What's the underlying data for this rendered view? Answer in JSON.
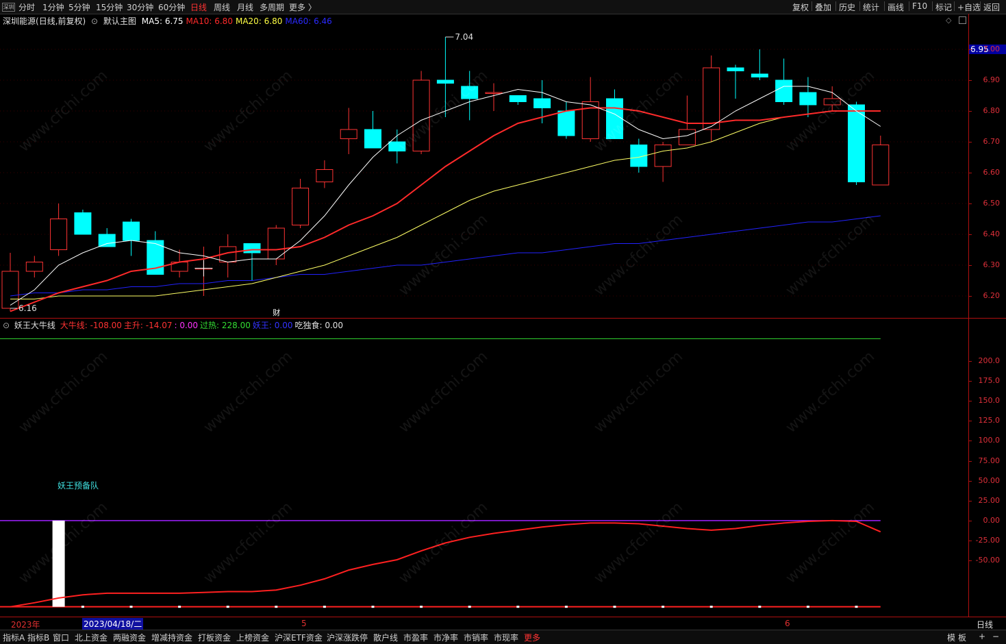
{
  "topbar": {
    "icon_label": "深圳",
    "periods": [
      "分时",
      "1分钟",
      "5分钟",
      "15分钟",
      "30分钟",
      "60分钟",
      "日线",
      "周线",
      "月线",
      "多周期",
      "更多 〉"
    ],
    "active_period": "日线",
    "tools": [
      "复权",
      "叠加",
      "历史",
      "统计",
      "画线",
      "F10",
      "标记",
      "+自选",
      "返回"
    ]
  },
  "main": {
    "stock_name": "深圳能源",
    "adj_mode": "(日线,前复权)",
    "chart_name": "默认主图",
    "ma": [
      {
        "label": "MA5:",
        "value": "6.75",
        "color": "#ffffff"
      },
      {
        "label": "MA10:",
        "value": "6.80",
        "color": "#ff2a2a"
      },
      {
        "label": "MA20:",
        "value": "6.80",
        "color": "#ffff44"
      },
      {
        "label": "MA60:",
        "value": "6.46",
        "color": "#2a2aff"
      }
    ],
    "current_price": "6.95",
    "high_label": "7.04",
    "low_label": "6.16",
    "finance_marker": "财",
    "y_ticks": [
      "7.00",
      "6.90",
      "6.80",
      "6.70",
      "6.60",
      "6.50",
      "6.40",
      "6.30",
      "6.20"
    ]
  },
  "indicator": {
    "name": "妖王大牛线",
    "items": [
      {
        "label": "大牛线:",
        "value": "-108.00",
        "color": "#ff3333"
      },
      {
        "label": "主升:",
        "value": "-14.07",
        "color": "#ff3333"
      },
      {
        "label": "",
        "value": ": 0.00",
        "color": "#ff33ff"
      },
      {
        "label": "过热:",
        "value": "228.00",
        "color": "#33dd33"
      },
      {
        "label": "妖王:",
        "value": "0.00",
        "color": "#3333ff"
      },
      {
        "label": "吃独食:",
        "value": "0.00",
        "color": "#e0e0e0"
      }
    ],
    "annotation": "妖王预备队",
    "y_ticks": [
      "200.0",
      "175.0",
      "150.0",
      "125.0",
      "100.0",
      "75.00",
      "50.00",
      "25.00",
      "0.00",
      "-25.00",
      "-50.00"
    ]
  },
  "xaxis": {
    "year_label": "2023年",
    "cursor_date": "2023/04/18/二",
    "month5": "5",
    "month6": "6",
    "period_label": "日线"
  },
  "bottombar": {
    "tabs": [
      "指标A",
      "指标B",
      "窗口",
      "北上资金",
      "两融资金",
      "增减持资金",
      "打板资金",
      "上榜资金",
      "沪深ETF资金",
      "沪深涨跌停",
      "散户线",
      "市盈率",
      "市净率",
      "市销率",
      "市现率",
      "更多"
    ],
    "active_tab": "更多",
    "right": [
      "模",
      "板",
      "+",
      "−"
    ]
  },
  "colors": {
    "up": "#ff3333",
    "down": "#00ffff",
    "ma5": "#ffffff",
    "ma10": "#ff2a2a",
    "ma20": "#ffff66",
    "ma60": "#2222ff"
  },
  "chart_data": {
    "type": "candlestick",
    "ylim": [
      6.14,
      7.06
    ],
    "candles": [
      {
        "o": 6.16,
        "h": 6.34,
        "l": 6.15,
        "c": 6.28
      },
      {
        "o": 6.28,
        "h": 6.33,
        "l": 6.26,
        "c": 6.31
      },
      {
        "o": 6.35,
        "h": 6.5,
        "l": 6.33,
        "c": 6.45
      },
      {
        "o": 6.47,
        "h": 6.48,
        "l": 6.4,
        "c": 6.4
      },
      {
        "o": 6.4,
        "h": 6.42,
        "l": 6.36,
        "c": 6.36
      },
      {
        "o": 6.44,
        "h": 6.45,
        "l": 6.33,
        "c": 6.38
      },
      {
        "o": 6.38,
        "h": 6.41,
        "l": 6.27,
        "c": 6.27
      },
      {
        "o": 6.28,
        "h": 6.35,
        "l": 6.26,
        "c": 6.31
      },
      {
        "o": 6.29,
        "h": 6.36,
        "l": 6.2,
        "c": 6.29
      },
      {
        "o": 6.31,
        "h": 6.4,
        "l": 6.26,
        "c": 6.36
      },
      {
        "o": 6.37,
        "h": 6.37,
        "l": 6.25,
        "c": 6.34
      },
      {
        "o": 6.32,
        "h": 6.43,
        "l": 6.3,
        "c": 6.42
      },
      {
        "o": 6.43,
        "h": 6.58,
        "l": 6.42,
        "c": 6.55
      },
      {
        "o": 6.57,
        "h": 6.64,
        "l": 6.55,
        "c": 6.61
      },
      {
        "o": 6.71,
        "h": 6.81,
        "l": 6.66,
        "c": 6.74
      },
      {
        "o": 6.74,
        "h": 6.8,
        "l": 6.68,
        "c": 6.68
      },
      {
        "o": 6.7,
        "h": 6.74,
        "l": 6.63,
        "c": 6.67
      },
      {
        "o": 6.67,
        "h": 6.93,
        "l": 6.66,
        "c": 6.9
      },
      {
        "o": 6.9,
        "h": 7.04,
        "l": 6.78,
        "c": 6.89
      },
      {
        "o": 6.88,
        "h": 6.93,
        "l": 6.77,
        "c": 6.84
      },
      {
        "o": 6.86,
        "h": 6.89,
        "l": 6.8,
        "c": 6.86
      },
      {
        "o": 6.85,
        "h": 6.85,
        "l": 6.82,
        "c": 6.83
      },
      {
        "o": 6.84,
        "h": 6.9,
        "l": 6.76,
        "c": 6.81
      },
      {
        "o": 6.8,
        "h": 6.83,
        "l": 6.71,
        "c": 6.72
      },
      {
        "o": 6.71,
        "h": 6.91,
        "l": 6.7,
        "c": 6.83
      },
      {
        "o": 6.84,
        "h": 6.87,
        "l": 6.71,
        "c": 6.71
      },
      {
        "o": 6.69,
        "h": 6.71,
        "l": 6.6,
        "c": 6.62
      },
      {
        "o": 6.62,
        "h": 6.7,
        "l": 6.57,
        "c": 6.69
      },
      {
        "o": 6.69,
        "h": 6.85,
        "l": 6.69,
        "c": 6.74
      },
      {
        "o": 6.74,
        "h": 6.98,
        "l": 6.7,
        "c": 6.94
      },
      {
        "o": 6.94,
        "h": 6.95,
        "l": 6.84,
        "c": 6.93
      },
      {
        "o": 6.92,
        "h": 7.0,
        "l": 6.9,
        "c": 6.91
      },
      {
        "o": 6.9,
        "h": 6.97,
        "l": 6.82,
        "c": 6.83
      },
      {
        "o": 6.86,
        "h": 6.91,
        "l": 6.78,
        "c": 6.82
      },
      {
        "o": 6.82,
        "h": 6.88,
        "l": 6.8,
        "c": 6.84
      },
      {
        "o": 6.82,
        "h": 6.83,
        "l": 6.56,
        "c": 6.57
      },
      {
        "o": 6.56,
        "h": 6.72,
        "l": 6.56,
        "c": 6.69
      }
    ],
    "ma5": [
      6.17,
      6.22,
      6.3,
      6.34,
      6.37,
      6.38,
      6.37,
      6.34,
      6.33,
      6.31,
      6.32,
      6.32,
      6.38,
      6.46,
      6.56,
      6.65,
      6.72,
      6.77,
      6.8,
      6.83,
      6.85,
      6.87,
      6.86,
      6.83,
      6.82,
      6.79,
      6.74,
      6.71,
      6.72,
      6.75,
      6.8,
      6.84,
      6.88,
      6.88,
      6.86,
      6.8,
      6.75
    ],
    "ma10": [
      6.15,
      6.18,
      6.21,
      6.23,
      6.25,
      6.28,
      6.29,
      6.31,
      6.32,
      6.34,
      6.35,
      6.35,
      6.36,
      6.39,
      6.43,
      6.46,
      6.5,
      6.56,
      6.62,
      6.67,
      6.72,
      6.76,
      6.78,
      6.8,
      6.81,
      6.81,
      6.8,
      6.78,
      6.76,
      6.76,
      6.77,
      6.77,
      6.78,
      6.79,
      6.8,
      6.8,
      6.8
    ],
    "ma20": [
      6.19,
      6.19,
      6.2,
      6.2,
      6.2,
      6.2,
      6.2,
      6.21,
      6.22,
      6.23,
      6.24,
      6.26,
      6.28,
      6.3,
      6.33,
      6.36,
      6.39,
      6.43,
      6.47,
      6.51,
      6.54,
      6.56,
      6.58,
      6.6,
      6.62,
      6.64,
      6.65,
      6.67,
      6.68,
      6.7,
      6.73,
      6.76,
      6.78,
      6.79,
      6.8,
      6.8,
      6.8
    ],
    "ma60": [
      6.2,
      6.21,
      6.21,
      6.22,
      6.22,
      6.23,
      6.23,
      6.24,
      6.24,
      6.25,
      6.25,
      6.26,
      6.27,
      6.27,
      6.28,
      6.29,
      6.3,
      6.3,
      6.31,
      6.32,
      6.33,
      6.34,
      6.34,
      6.35,
      6.36,
      6.37,
      6.37,
      6.38,
      6.39,
      6.4,
      6.41,
      6.42,
      6.43,
      6.44,
      6.44,
      6.45,
      6.46
    ],
    "indicator_ylim": [
      -110,
      230
    ],
    "main_rise": [
      -108,
      -103,
      -97,
      -93,
      -91,
      -91,
      -91,
      -91,
      -90,
      -89,
      -89,
      -87,
      -81,
      -73,
      -62,
      -55,
      -49,
      -38,
      -28,
      -21,
      -16,
      -12,
      -8,
      -5,
      -3,
      -3,
      -4,
      -7,
      -10,
      -12,
      -10,
      -6,
      -3,
      -1,
      0,
      -1,
      -14
    ],
    "overheat": 228,
    "bar_index": 2
  }
}
